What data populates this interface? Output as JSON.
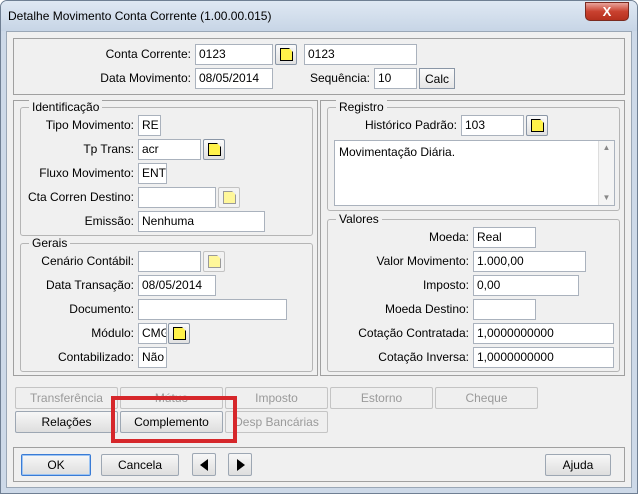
{
  "window": {
    "title": "Detalhe Movimento Conta Corrente (1.00.00.015)",
    "close_glyph": "X"
  },
  "header": {
    "conta_corrente_label": "Conta Corrente:",
    "conta_corrente_code": "0123",
    "conta_corrente_desc": "0123",
    "data_movimento_label": "Data Movimento:",
    "data_movimento_value": "08/05/2014",
    "sequencia_label": "Sequência:",
    "sequencia_value": "10",
    "calc_label": "Calc"
  },
  "identificacao": {
    "legend": "Identificação",
    "tipo_movimento_label": "Tipo Movimento:",
    "tipo_movimento_value": "RE",
    "tp_trans_label": "Tp Trans:",
    "tp_trans_value": "acr",
    "fluxo_movimento_label": "Fluxo Movimento:",
    "fluxo_movimento_value": "ENT",
    "cta_corren_destino_label": "Cta Corren Destino:",
    "cta_corren_destino_value": "",
    "emissao_label": "Emissão:",
    "emissao_value": "Nenhuma"
  },
  "gerais": {
    "legend": "Gerais",
    "cenario_contabil_label": "Cenário Contábil:",
    "cenario_contabil_value": "",
    "data_transacao_label": "Data Transação:",
    "data_transacao_value": "08/05/2014",
    "documento_label": "Documento:",
    "documento_value": "",
    "modulo_label": "Módulo:",
    "modulo_value": "CMG",
    "contabilizado_label": "Contabilizado:",
    "contabilizado_value": "Não"
  },
  "registro": {
    "legend": "Registro",
    "historico_padrao_label": "Histórico Padrão:",
    "historico_padrao_value": "103",
    "memo_text": "Movimentação Diária."
  },
  "valores": {
    "legend": "Valores",
    "moeda_label": "Moeda:",
    "moeda_value": "Real",
    "valor_movimento_label": "Valor Movimento:",
    "valor_movimento_value": "1.000,00",
    "imposto_label": "Imposto:",
    "imposto_value": "0,00",
    "moeda_destino_label": "Moeda Destino:",
    "moeda_destino_value": "",
    "cotacao_contratada_label": "Cotação Contratada:",
    "cotacao_contratada_value": "1,0000000000",
    "cotacao_inversa_label": "Cotação Inversa:",
    "cotacao_inversa_value": "1,0000000000"
  },
  "actions": {
    "transferencia": "Transferência",
    "motivo": "Mútuo",
    "imposto": "Imposto",
    "estorno": "Estorno",
    "cheque": "Cheque",
    "relacoes": "Relações",
    "complemento": "Complemento",
    "desp_bancarias": "Desp Bancárias"
  },
  "footer": {
    "ok": "OK",
    "cancela": "Cancela",
    "ajuda": "Ajuda"
  },
  "colors": {
    "highlight": "#d6272b",
    "window_frame": "#cdd9e8",
    "close_button": "#c9412f",
    "lookup_icon": "#fff24a"
  }
}
